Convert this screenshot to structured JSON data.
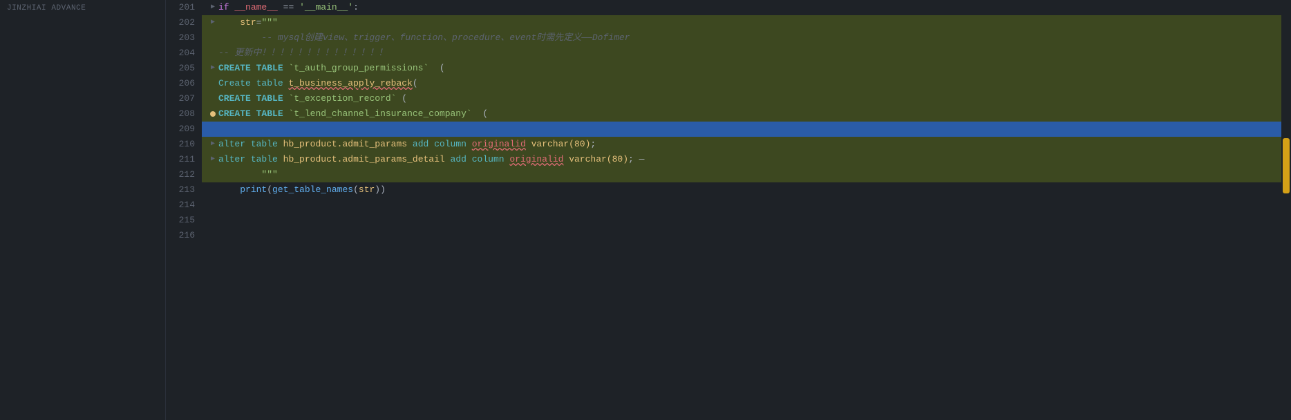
{
  "editor": {
    "sidebar_title": "JINZHIAI ADVANCE",
    "lines": [
      {
        "num": "201",
        "indent": "",
        "tokens": "if_main_check",
        "highlighted": false,
        "selected": false,
        "fold": "▶"
      },
      {
        "num": "202",
        "indent": "    ",
        "tokens": "str_assign",
        "highlighted": true,
        "selected": false,
        "fold": "▶"
      },
      {
        "num": "203",
        "indent": "        ",
        "tokens": "comment_mysql",
        "highlighted": true,
        "selected": false
      },
      {
        "num": "204",
        "indent": "",
        "tokens": "comment_dashes",
        "highlighted": true,
        "selected": false
      },
      {
        "num": "205",
        "indent": "",
        "tokens": "create_table_1",
        "highlighted": true,
        "selected": false,
        "fold": "▶"
      },
      {
        "num": "206",
        "indent": "",
        "tokens": "create_table_2",
        "highlighted": true,
        "selected": false
      },
      {
        "num": "207",
        "indent": "",
        "tokens": "create_table_3",
        "highlighted": true,
        "selected": false
      },
      {
        "num": "208",
        "indent": "",
        "tokens": "create_table_4",
        "highlighted": true,
        "selected": false,
        "warning": true
      },
      {
        "num": "209",
        "indent": "",
        "tokens": "empty_selected",
        "highlighted": false,
        "selected": true
      },
      {
        "num": "210",
        "indent": "",
        "tokens": "alter_1",
        "highlighted": true,
        "selected": false,
        "fold": "▶"
      },
      {
        "num": "211",
        "indent": "",
        "tokens": "alter_2",
        "highlighted": true,
        "selected": false,
        "fold": "▶"
      },
      {
        "num": "212",
        "indent": "        ",
        "tokens": "str_end",
        "highlighted": true,
        "selected": false
      },
      {
        "num": "213",
        "indent": "    ",
        "tokens": "print_call",
        "highlighted": false,
        "selected": false
      },
      {
        "num": "214",
        "indent": "",
        "tokens": "empty",
        "highlighted": false,
        "selected": false
      },
      {
        "num": "215",
        "indent": "",
        "tokens": "empty",
        "highlighted": false,
        "selected": false
      },
      {
        "num": "216",
        "indent": "",
        "tokens": "empty",
        "highlighted": false,
        "selected": false
      }
    ]
  }
}
